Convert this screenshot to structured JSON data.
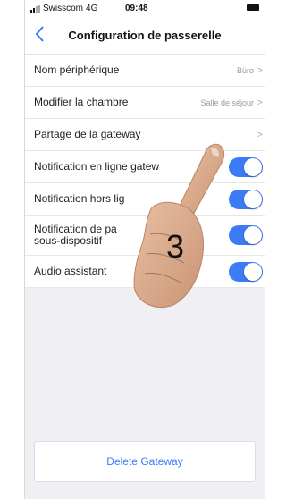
{
  "status": {
    "carrier": "Swisscom",
    "network": "4G",
    "time": "09:48"
  },
  "nav": {
    "title": "Configuration de passerelle",
    "back_icon": "chevron-left-icon"
  },
  "rows": [
    {
      "label": "Nom périphérique",
      "value": "Büro"
    },
    {
      "label": "Modifier la chambre",
      "value": "Salle de séjour"
    },
    {
      "label": "Partage de la gateway",
      "value": ""
    },
    {
      "label": "Notification en ligne gatew",
      "toggle": true
    },
    {
      "label": "Notification hors lig",
      "toggle": true
    },
    {
      "label": "Notification de pa\nsous-dispositif",
      "toggle": true
    },
    {
      "label": "Audio assistant",
      "toggle": true
    }
  ],
  "overlay": {
    "step_number": "3"
  },
  "delete_label": "Delete Gateway",
  "colors": {
    "accent": "#3b7cf6",
    "background": "#efeff4"
  }
}
